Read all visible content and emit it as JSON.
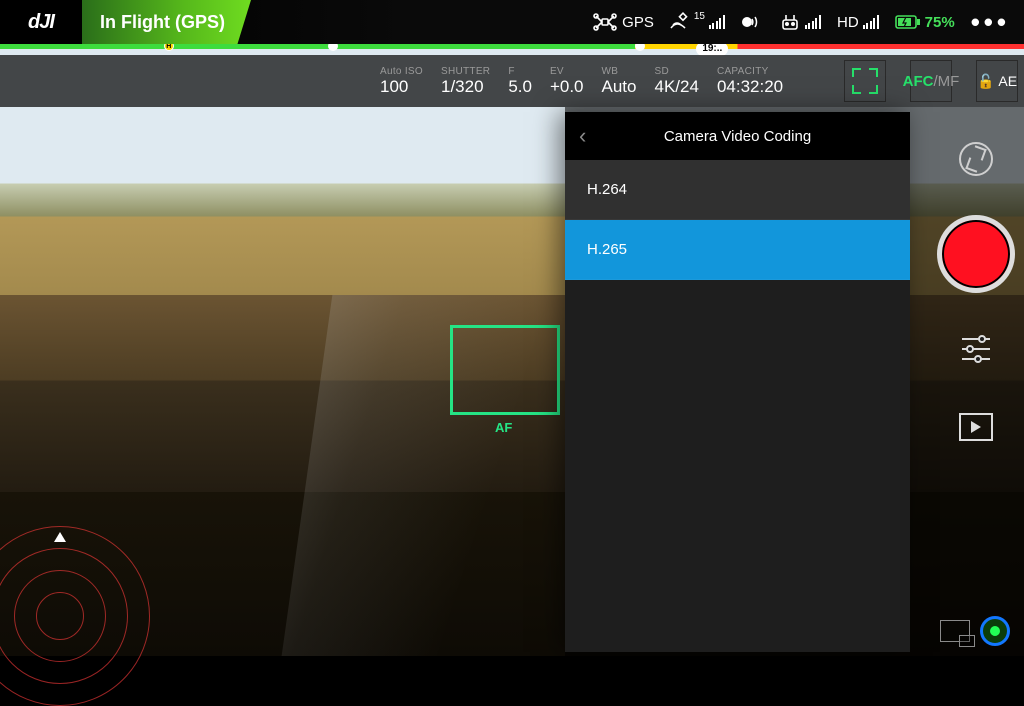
{
  "brand": "dJI",
  "flight_status": "In Flight (GPS)",
  "top": {
    "gps_label": "GPS",
    "sat_count": "15",
    "hd_label": "HD",
    "timer_pill": "19:..",
    "battery_pct": "75%"
  },
  "camera": {
    "iso": {
      "label": "Auto ISO",
      "value": "100"
    },
    "shutter": {
      "label": "SHUTTER",
      "value": "1/320"
    },
    "aperture": {
      "label": "F",
      "value": "5.0"
    },
    "ev": {
      "label": "EV",
      "value": "+0.0"
    },
    "wb": {
      "label": "WB",
      "value": "Auto"
    },
    "format": {
      "label": "SD ",
      "value": "4K/24"
    },
    "capacity": {
      "label": "CAPACITY",
      "value": "04:32:20"
    },
    "focus_mode_afc": "AFC",
    "focus_mode_mf": "MF",
    "ae_lock": "AE"
  },
  "reticle_label": "AF",
  "panel": {
    "title": "Camera Video Coding",
    "options": [
      "H.264",
      "H.265"
    ],
    "selected_index": 1
  },
  "icons": {
    "drone": "drone-icon",
    "satellite": "satellite-icon",
    "rc_signal": "rc-signal-icon",
    "hd_signal": "hd-signal-icon",
    "battery": "battery-icon",
    "vision": "vision-sensor-icon",
    "menu": "•••",
    "back": "‹",
    "lock": "🔓"
  },
  "colors": {
    "accent_green": "#26e06a",
    "select_blue": "#1296db",
    "record_red": "#ff1020",
    "battery_green": "#45e05a"
  }
}
